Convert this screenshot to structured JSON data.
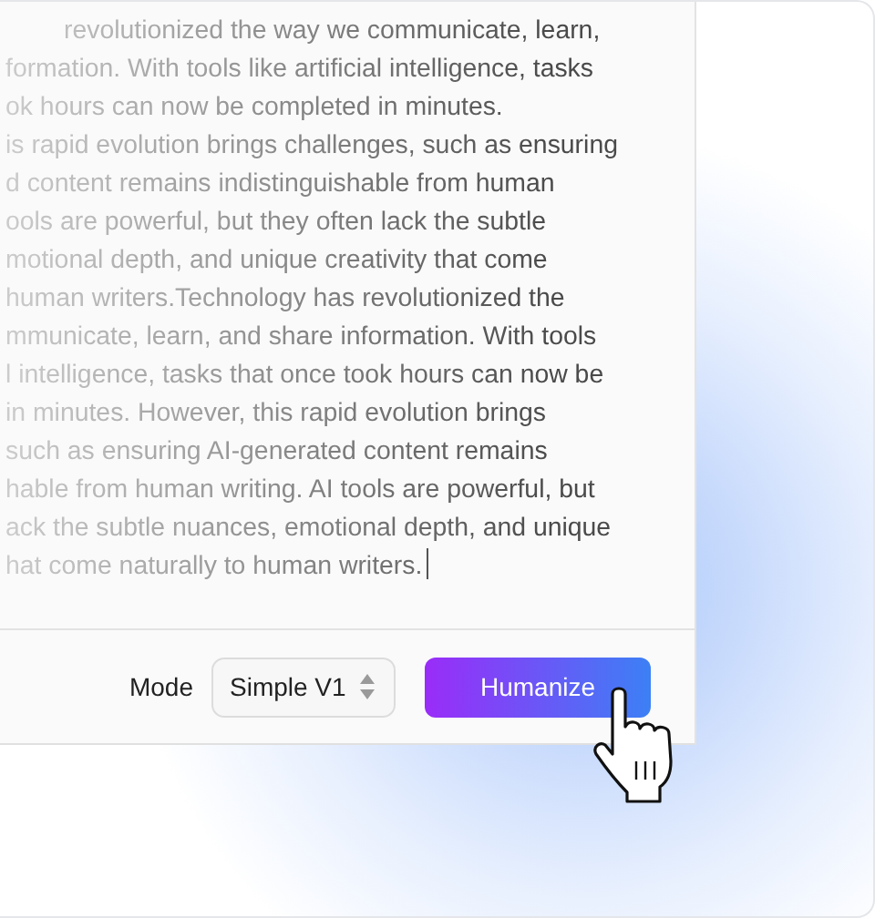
{
  "editor": {
    "lines": [
      "revolutionized the way we communicate, learn,",
      "formation. With tools like artificial intelligence, tasks",
      "ok hours can now be completed in minutes.",
      "is rapid evolution brings challenges, such as ensuring",
      "d content remains indistinguishable from human",
      "ools are powerful, but they often lack the subtle",
      "motional depth, and unique creativity that come",
      "human writers.Technology has revolutionized the",
      "mmunicate, learn, and share information. With tools",
      "l intelligence, tasks that once took hours can now be",
      "in minutes. However, this rapid evolution brings",
      "such as ensuring AI-generated content remains",
      "hable from human writing. AI tools are powerful, but",
      "ack the subtle nuances, emotional depth, and unique",
      "hat come naturally to human writers."
    ],
    "caret": true
  },
  "footer": {
    "mode_label": "Mode",
    "mode_select": {
      "value": "Simple V1"
    },
    "button": "Humanize"
  }
}
